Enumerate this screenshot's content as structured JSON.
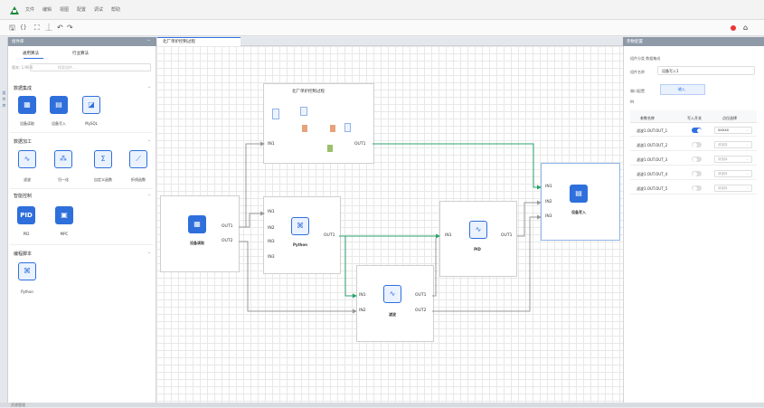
{
  "menu": {
    "items": [
      "文件",
      "编辑",
      "视图",
      "配置",
      "调试",
      "帮助"
    ]
  },
  "toolbar": {
    "icons": [
      "save-icon",
      "braces-icon",
      "fit-icon",
      "align-icon",
      "undo-icon",
      "redo-icon"
    ],
    "glyphs": [
      "🖫",
      "{}",
      "⛶",
      "⏊",
      "↶",
      "↷"
    ]
  },
  "left_rail": {
    "labels": [
      "组",
      "件",
      "库"
    ]
  },
  "library": {
    "title": "组件库",
    "tabs": [
      "通用算法",
      "行业算法"
    ],
    "version": "版本: 1.90.6",
    "search_placeholder": "搜索组件...",
    "sections": [
      {
        "title": "数据集成",
        "items": [
          {
            "label": "设备读取",
            "glyph": "▦"
          },
          {
            "label": "设备写入",
            "glyph": "▤"
          },
          {
            "label": "MySQL",
            "glyph": "◪"
          }
        ]
      },
      {
        "title": "数据加工",
        "items": [
          {
            "label": "滤波",
            "glyph": "∿"
          },
          {
            "label": "归一化",
            "glyph": "⁂"
          },
          {
            "label": "自定义函数",
            "glyph": "Σ"
          },
          {
            "label": "折线函数",
            "glyph": "⟋"
          }
        ]
      },
      {
        "title": "智能控制",
        "items": [
          {
            "label": "PID",
            "glyph": "PID"
          },
          {
            "label": "MPC",
            "glyph": "▣"
          }
        ]
      },
      {
        "title": "编程脚本",
        "items": [
          {
            "label": "Python",
            "glyph": "⌘"
          }
        ]
      }
    ]
  },
  "canvas": {
    "tab_label": "北厂单炉控制过程",
    "group": {
      "title": "北厂单炉控制过程",
      "in": "IN1",
      "out": "OUT1"
    },
    "nodes": {
      "reader": {
        "label": "设备读取",
        "ports_out": [
          "OUT1",
          "OUT2"
        ],
        "glyph": "▦"
      },
      "python": {
        "label": "Python",
        "ports_in": [
          "IN1",
          "IN2",
          "IN3",
          "IN3"
        ],
        "ports_out": [
          "OUT1"
        ],
        "glyph": "⌘"
      },
      "pid": {
        "label": "PID",
        "ports_in": [
          "IN1"
        ],
        "ports_out": [
          "OUT1"
        ],
        "glyph": "∿"
      },
      "filter": {
        "label": "滤波",
        "ports_in": [
          "IN1",
          "IN2"
        ],
        "ports_out": [
          "OUT1",
          "OUT2"
        ],
        "glyph": "∿"
      },
      "writer": {
        "label": "设备写入",
        "ports_in": [
          "IN1",
          "IN2",
          "IN3"
        ],
        "glyph": "▤"
      }
    }
  },
  "props": {
    "title": "参数配置",
    "component_type": "组件分类  数据集成",
    "name_label": "组件名称",
    "name_value": "设备写入1",
    "port_config": "端口配置",
    "port_tab": "输入",
    "port_sub": "IN",
    "columns": [
      "参数名称",
      "写入开关",
      "点位选择"
    ],
    "rows": [
      {
        "name": "滤波1.OUT.OUT_1",
        "on": true,
        "point": "XXXXX"
      },
      {
        "name": "滤波1.OUT.OUT_2",
        "on": false,
        "point": "请选择"
      },
      {
        "name": "滤波1.OUT.OUT_3",
        "on": false,
        "point": "请选择"
      },
      {
        "name": "滤波1.OUT.OUT_4",
        "on": false,
        "point": "请选择"
      },
      {
        "name": "滤波1.OUT.OUT_5",
        "on": false,
        "point": "请选择"
      }
    ]
  },
  "bottom": {
    "label": "资源管理"
  },
  "colors": {
    "accent": "#2e6fdc",
    "wire_active": "#2aa36b",
    "wire_inactive": "#999999",
    "status_red": "#e33333"
  }
}
